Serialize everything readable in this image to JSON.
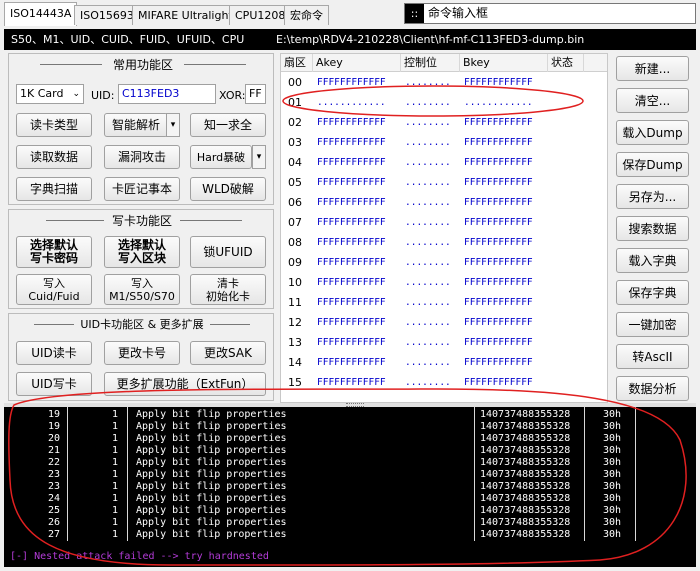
{
  "tabs": [
    "ISO14443A",
    "ISO15693",
    "MIFARE Ultralight",
    "CPU1208",
    "宏命令"
  ],
  "command_box": {
    "icon": "::",
    "title": "命令输入框"
  },
  "infobar": {
    "left": "S50、M1、UID、CUID、FUID、UFUID、CPU",
    "right": "E:\\temp\\RDV4-210228\\Client\\hf-mf-C113FED3-dump.bin"
  },
  "common": {
    "title": "常用功能区",
    "card_select": "1K Card",
    "uid_label": "UID:",
    "uid_value": "C113FED3",
    "xor_label": "XOR:",
    "xor_value": "FF",
    "buttons": [
      "读卡类型",
      "智能解析",
      "知一求全",
      "读取数据",
      "漏洞攻击",
      "Hard暴破",
      "字典扫描",
      "卡匠记事本",
      "WLD破解"
    ]
  },
  "write": {
    "title": "写卡功能区",
    "buttons": [
      "选择默认\n写卡密码",
      "选择默认\n写入区块",
      "锁UFUID",
      "写入\nCuid/Fuid",
      "写入\nM1/S50/S70",
      "清卡\n初始化卡"
    ]
  },
  "uid": {
    "title": "UID卡功能区 & 更多扩展",
    "buttons": [
      "UID读卡",
      "更改卡号",
      "更改SAK",
      "UID写卡",
      "更多扩展功能（ExtFun）"
    ]
  },
  "table": {
    "headers": [
      "扇区",
      "Akey",
      "控制位",
      "Bkey",
      "状态"
    ],
    "rows": [
      {
        "sector": "00",
        "akey": "FFFFFFFFFFFF",
        "ctrl": "........",
        "bkey": "FFFFFFFFFFFF"
      },
      {
        "sector": "01",
        "akey": "............",
        "ctrl": "........",
        "bkey": "............"
      },
      {
        "sector": "02",
        "akey": "FFFFFFFFFFFF",
        "ctrl": "........",
        "bkey": "FFFFFFFFFFFF"
      },
      {
        "sector": "03",
        "akey": "FFFFFFFFFFFF",
        "ctrl": "........",
        "bkey": "FFFFFFFFFFFF"
      },
      {
        "sector": "04",
        "akey": "FFFFFFFFFFFF",
        "ctrl": "........",
        "bkey": "FFFFFFFFFFFF"
      },
      {
        "sector": "05",
        "akey": "FFFFFFFFFFFF",
        "ctrl": "........",
        "bkey": "FFFFFFFFFFFF"
      },
      {
        "sector": "06",
        "akey": "FFFFFFFFFFFF",
        "ctrl": "........",
        "bkey": "FFFFFFFFFFFF"
      },
      {
        "sector": "07",
        "akey": "FFFFFFFFFFFF",
        "ctrl": "........",
        "bkey": "FFFFFFFFFFFF"
      },
      {
        "sector": "08",
        "akey": "FFFFFFFFFFFF",
        "ctrl": "........",
        "bkey": "FFFFFFFFFFFF"
      },
      {
        "sector": "09",
        "akey": "FFFFFFFFFFFF",
        "ctrl": "........",
        "bkey": "FFFFFFFFFFFF"
      },
      {
        "sector": "10",
        "akey": "FFFFFFFFFFFF",
        "ctrl": "........",
        "bkey": "FFFFFFFFFFFF"
      },
      {
        "sector": "11",
        "akey": "FFFFFFFFFFFF",
        "ctrl": "........",
        "bkey": "FFFFFFFFFFFF"
      },
      {
        "sector": "12",
        "akey": "FFFFFFFFFFFF",
        "ctrl": "........",
        "bkey": "FFFFFFFFFFFF"
      },
      {
        "sector": "13",
        "akey": "FFFFFFFFFFFF",
        "ctrl": "........",
        "bkey": "FFFFFFFFFFFF"
      },
      {
        "sector": "14",
        "akey": "FFFFFFFFFFFF",
        "ctrl": "........",
        "bkey": "FFFFFFFFFFFF"
      },
      {
        "sector": "15",
        "akey": "FFFFFFFFFFFF",
        "ctrl": "........",
        "bkey": "FFFFFFFFFFFF"
      }
    ]
  },
  "right_buttons": [
    "新建...",
    "清空...",
    "载入Dump",
    "保存Dump",
    "另存为...",
    "搜索数据",
    "载入字典",
    "保存字典",
    "一键加密",
    "转AscII",
    "数据分析"
  ],
  "console": {
    "rows": [
      {
        "n": "19",
        "k": "1",
        "text": "Apply bit flip properties",
        "num": "140737488355328",
        "h": "30h"
      },
      {
        "n": "19",
        "k": "1",
        "text": "Apply bit flip properties",
        "num": "140737488355328",
        "h": "30h"
      },
      {
        "n": "20",
        "k": "1",
        "text": "Apply bit flip properties",
        "num": "140737488355328",
        "h": "30h"
      },
      {
        "n": "21",
        "k": "1",
        "text": "Apply bit flip properties",
        "num": "140737488355328",
        "h": "30h"
      },
      {
        "n": "22",
        "k": "1",
        "text": "Apply bit flip properties",
        "num": "140737488355328",
        "h": "30h"
      },
      {
        "n": "23",
        "k": "1",
        "text": "Apply bit flip properties",
        "num": "140737488355328",
        "h": "30h"
      },
      {
        "n": "23",
        "k": "1",
        "text": "Apply bit flip properties",
        "num": "140737488355328",
        "h": "30h"
      },
      {
        "n": "24",
        "k": "1",
        "text": "Apply bit flip properties",
        "num": "140737488355328",
        "h": "30h"
      },
      {
        "n": "25",
        "k": "1",
        "text": "Apply bit flip properties",
        "num": "140737488355328",
        "h": "30h"
      },
      {
        "n": "26",
        "k": "1",
        "text": "Apply bit flip properties",
        "num": "140737488355328",
        "h": "30h"
      },
      {
        "n": "27",
        "k": "1",
        "text": "Apply bit flip properties",
        "num": "140737488355328",
        "h": "30h"
      }
    ],
    "message": "[-] Nested attack failed --> try hardnested"
  },
  "colors": {
    "key_blue": "#0000cc",
    "annotation_red": "#e02020",
    "console_msg": "#b43cd8"
  }
}
